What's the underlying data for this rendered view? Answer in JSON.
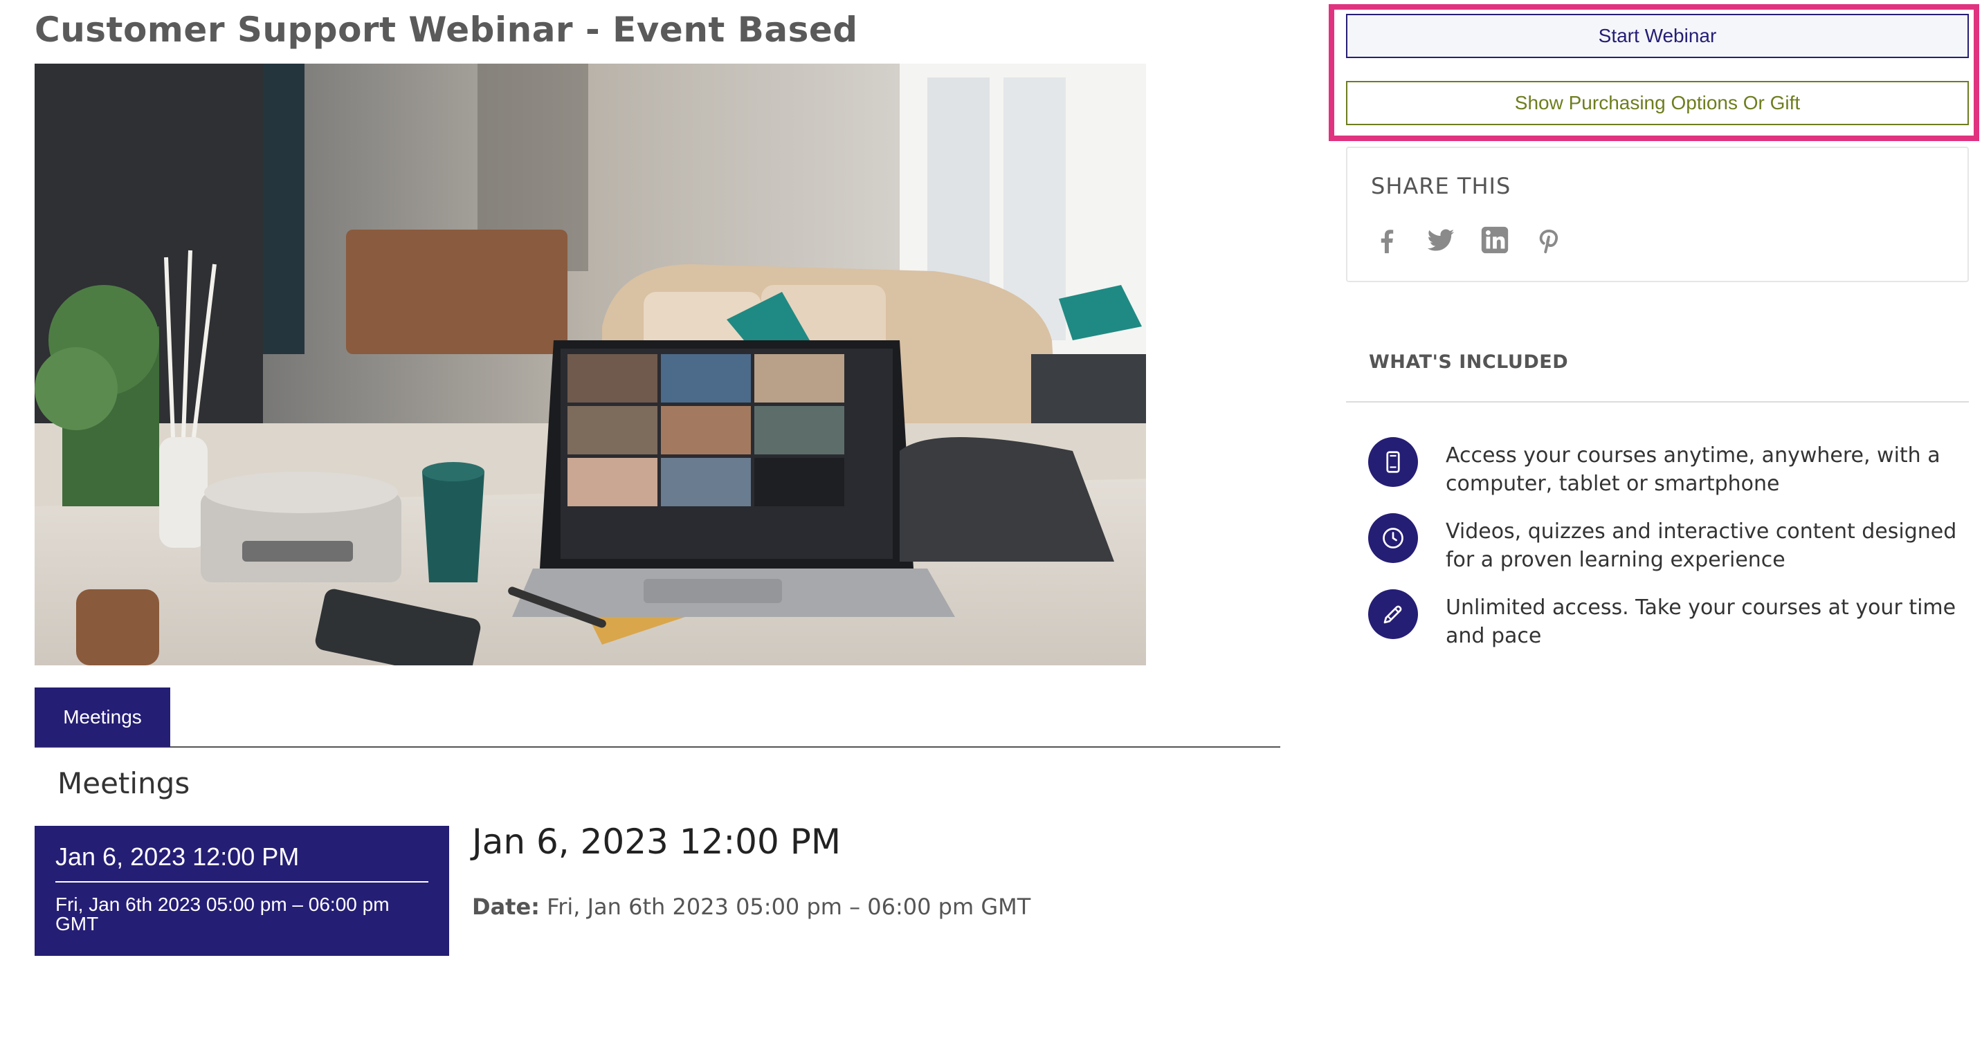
{
  "page": {
    "title": "Customer Support Webinar - Event Based"
  },
  "hero": {
    "alt": "Laptop on a desk showing a video meeting grid"
  },
  "tabs": [
    {
      "label": "Meetings",
      "active": true
    }
  ],
  "meetings_section": {
    "heading": "Meetings",
    "card": {
      "title": "Jan 6, 2023 12:00 PM",
      "subtitle": "Fri, Jan 6th 2023 05:00 pm – 06:00 pm GMT"
    },
    "detail": {
      "title": "Jan 6, 2023 12:00 PM",
      "date_label": "Date:",
      "date_value": "Fri, Jan 6th 2023 05:00 pm – 06:00 pm GMT"
    }
  },
  "sidebar": {
    "start_button": "Start Webinar",
    "purchase_button": "Show Purchasing Options Or Gift",
    "share": {
      "title": "SHARE THIS",
      "icons": [
        "facebook-icon",
        "twitter-icon",
        "linkedin-icon",
        "pinterest-icon"
      ]
    },
    "included": {
      "title": "WHAT'S INCLUDED",
      "items": [
        {
          "icon": "smartphone-icon",
          "text": "Access your courses anytime, anywhere, with a computer, tablet or smartphone"
        },
        {
          "icon": "clock-icon",
          "text": "Videos, quizzes and interactive content designed for a proven learning experience"
        },
        {
          "icon": "pencil-icon",
          "text": "Unlimited access. Take your courses at your time and pace"
        }
      ]
    }
  },
  "colors": {
    "brand": "#251e75",
    "highlight": "#e0337f",
    "purchase": "#6e7d1e",
    "share_icon": "#8a8a8a"
  }
}
